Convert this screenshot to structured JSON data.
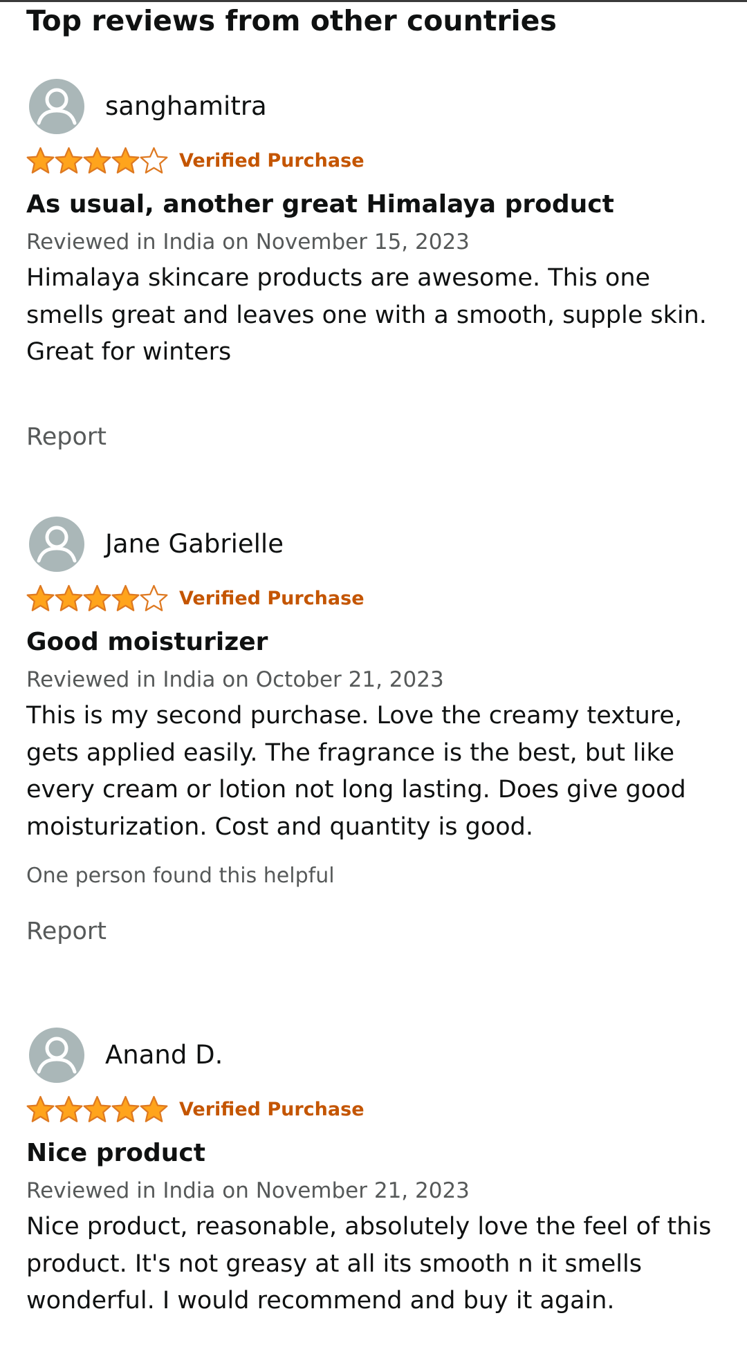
{
  "section_title": "Top reviews from other countries",
  "star_colors": {
    "filled": "#ffa41c",
    "outline": "#de7921",
    "empty": "#ffffff"
  },
  "reviews": [
    {
      "reviewer": "sanghamitra",
      "rating": 4,
      "max_rating": 5,
      "verified": "Verified Purchase",
      "title": "As usual, another great Himalaya product",
      "date": "Reviewed in India on November 15, 2023",
      "body": "Himalaya skincare products are awesome. This one smells great and leaves one with a smooth, supple skin. Great for winters",
      "helpful": "",
      "report": "Report"
    },
    {
      "reviewer": "Jane Gabrielle",
      "rating": 4,
      "max_rating": 5,
      "verified": "Verified Purchase",
      "title": "Good moisturizer",
      "date": "Reviewed in India on October 21, 2023",
      "body": "This is my second purchase. Love the creamy texture, gets applied easily. The fragrance is the best, but like every cream or lotion not long lasting. Does give good moisturization. Cost and quantity is good.",
      "helpful": "One person found this helpful",
      "report": "Report"
    },
    {
      "reviewer": "Anand D.",
      "rating": 5,
      "max_rating": 5,
      "verified": "Verified Purchase",
      "title": "Nice product",
      "date": "Reviewed in India on November 21, 2023",
      "body": "Nice product, reasonable, absolutely love the feel of this product. It's not greasy at all its smooth n it smells wonderful. I would recommend and buy it again.",
      "helpful": "",
      "report": ""
    }
  ]
}
